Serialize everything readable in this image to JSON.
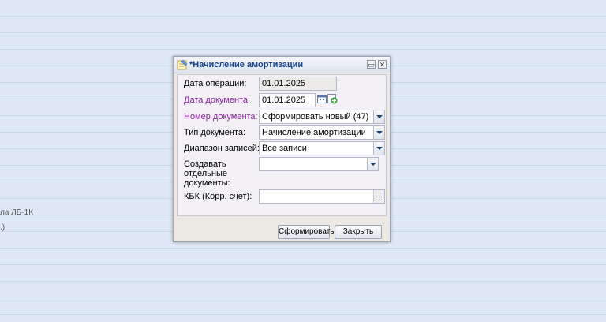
{
  "background": {
    "text_line1": "ла ЛБ-1К",
    "text_line2": ".)"
  },
  "dialog": {
    "title": "*Начисление амортизации",
    "title_icon": "document-edit-icon",
    "restore_glyph": "▭",
    "close_glyph": "✕",
    "fields": {
      "operation_date": {
        "label": "Дата операции:",
        "value": "01.01.2025"
      },
      "document_date": {
        "label": "Дата документа:",
        "value": "01.01.2025"
      },
      "document_number": {
        "label": "Номер документа:",
        "value": "Сформировать новый (47)"
      },
      "document_type": {
        "label": "Тип документа:",
        "value": "Начисление амортизации"
      },
      "record_range": {
        "label": "Диапазон записей:",
        "value": "Все записи"
      },
      "separate_docs": {
        "label_line1": "Создавать",
        "label_line2": "отдельные",
        "label_line3": "документы:",
        "value": ""
      },
      "kbk": {
        "label": "КБК (Корр. счет):",
        "value": "",
        "dots": "…"
      }
    },
    "buttons": {
      "form": "Сформировать",
      "close": "Закрыть"
    },
    "colors": {
      "required_label": "#8b1fa0",
      "title_text": "#15428b"
    }
  }
}
